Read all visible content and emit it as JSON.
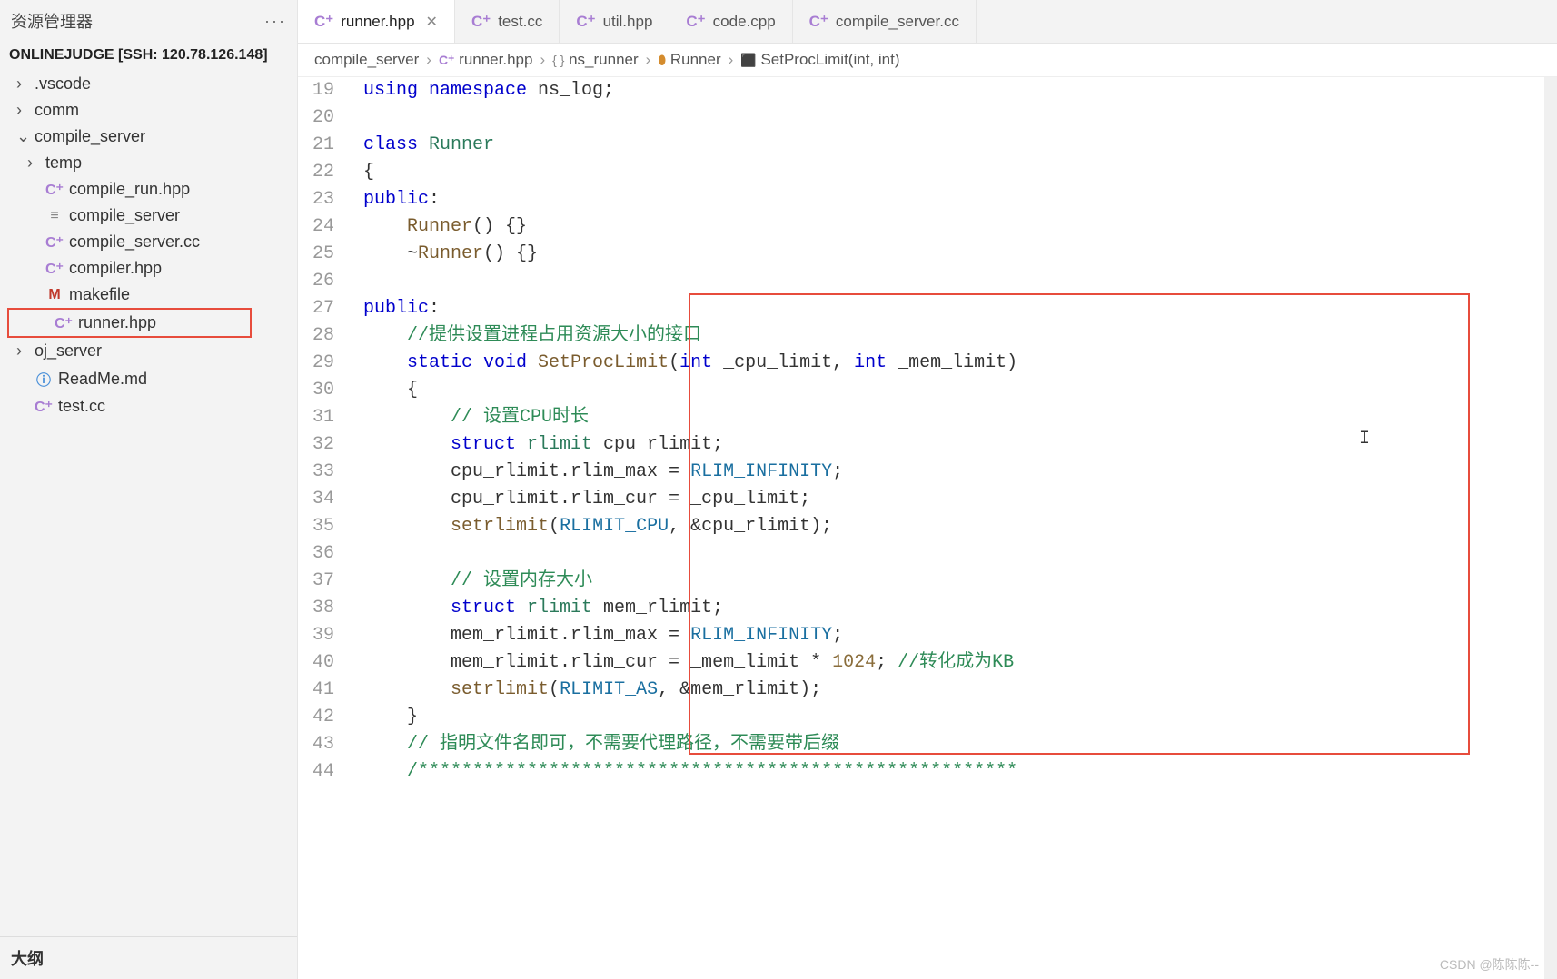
{
  "sidebar": {
    "title": "资源管理器",
    "workspace": "ONLINEJUDGE [SSH: 120.78.126.148]",
    "outline": "大纲",
    "items": [
      {
        "label": ".vscode",
        "type": "folder",
        "indent": 0,
        "expanded": false
      },
      {
        "label": "comm",
        "type": "folder",
        "indent": 0,
        "expanded": false
      },
      {
        "label": "compile_server",
        "type": "folder",
        "indent": 0,
        "expanded": true
      },
      {
        "label": "temp",
        "type": "folder",
        "indent": 1,
        "expanded": false
      },
      {
        "label": "compile_run.hpp",
        "type": "hpp",
        "indent": 1
      },
      {
        "label": "compile_server",
        "type": "file",
        "indent": 1
      },
      {
        "label": "compile_server.cc",
        "type": "cpp",
        "indent": 1
      },
      {
        "label": "compiler.hpp",
        "type": "hpp",
        "indent": 1
      },
      {
        "label": "makefile",
        "type": "m",
        "indent": 1
      },
      {
        "label": "runner.hpp",
        "type": "hpp",
        "indent": 1,
        "highlight": true
      },
      {
        "label": "oj_server",
        "type": "folder",
        "indent": 0,
        "expanded": false
      },
      {
        "label": "ReadMe.md",
        "type": "md",
        "indent": 0
      },
      {
        "label": "test.cc",
        "type": "cpp",
        "indent": 0
      }
    ]
  },
  "tabs": [
    {
      "label": "runner.hpp",
      "icon": "hpp",
      "active": true,
      "hasClose": true
    },
    {
      "label": "test.cc",
      "icon": "cpp",
      "active": false
    },
    {
      "label": "util.hpp",
      "icon": "hpp",
      "active": false
    },
    {
      "label": "code.cpp",
      "icon": "cpp",
      "active": false
    },
    {
      "label": "compile_server.cc",
      "icon": "cpp",
      "active": false
    }
  ],
  "breadcrumb": [
    {
      "label": "compile_server",
      "icon": ""
    },
    {
      "label": "runner.hpp",
      "icon": "hpp"
    },
    {
      "label": "ns_runner",
      "icon": "braces"
    },
    {
      "label": "Runner",
      "icon": "class"
    },
    {
      "label": "SetProcLimit(int, int)",
      "icon": "method"
    }
  ],
  "code": {
    "startLine": 19,
    "lines": [
      {
        "n": 19,
        "tokens": [
          {
            "t": "using ",
            "c": "kw"
          },
          {
            "t": "namespace",
            "c": "kw"
          },
          {
            "t": " ns_log;",
            "c": ""
          }
        ]
      },
      {
        "n": 20,
        "tokens": []
      },
      {
        "n": 21,
        "tokens": [
          {
            "t": "class ",
            "c": "kw"
          },
          {
            "t": "Runner",
            "c": "type"
          }
        ]
      },
      {
        "n": 22,
        "tokens": [
          {
            "t": "{",
            "c": ""
          }
        ]
      },
      {
        "n": 23,
        "tokens": [
          {
            "t": "public",
            "c": "kw"
          },
          {
            "t": ":",
            "c": ""
          }
        ]
      },
      {
        "n": 24,
        "tokens": [
          {
            "t": "    ",
            "c": ""
          },
          {
            "t": "Runner",
            "c": "func"
          },
          {
            "t": "() {}",
            "c": ""
          }
        ]
      },
      {
        "n": 25,
        "tokens": [
          {
            "t": "    ~",
            "c": ""
          },
          {
            "t": "Runner",
            "c": "func"
          },
          {
            "t": "() {}",
            "c": ""
          }
        ]
      },
      {
        "n": 26,
        "tokens": []
      },
      {
        "n": 27,
        "tokens": [
          {
            "t": "public",
            "c": "kw"
          },
          {
            "t": ":",
            "c": ""
          }
        ]
      },
      {
        "n": 28,
        "tokens": [
          {
            "t": "    ",
            "c": ""
          },
          {
            "t": "//提供设置进程占用资源大小的接口",
            "c": "comment"
          }
        ]
      },
      {
        "n": 29,
        "tokens": [
          {
            "t": "    ",
            "c": ""
          },
          {
            "t": "static ",
            "c": "kw"
          },
          {
            "t": "void ",
            "c": "kw"
          },
          {
            "t": "SetProcLimit",
            "c": "func"
          },
          {
            "t": "(",
            "c": ""
          },
          {
            "t": "int",
            "c": "kw"
          },
          {
            "t": " _cpu_limit, ",
            "c": ""
          },
          {
            "t": "int",
            "c": "kw"
          },
          {
            "t": " _mem_limit)",
            "c": ""
          }
        ]
      },
      {
        "n": 30,
        "tokens": [
          {
            "t": "    {",
            "c": ""
          }
        ]
      },
      {
        "n": 31,
        "tokens": [
          {
            "t": "        ",
            "c": ""
          },
          {
            "t": "// 设置CPU时长",
            "c": "comment"
          }
        ]
      },
      {
        "n": 32,
        "tokens": [
          {
            "t": "        ",
            "c": ""
          },
          {
            "t": "struct ",
            "c": "kw"
          },
          {
            "t": "rlimit",
            "c": "type"
          },
          {
            "t": " cpu_rlimit;",
            "c": ""
          }
        ]
      },
      {
        "n": 33,
        "tokens": [
          {
            "t": "        cpu_rlimit.rlim_max = ",
            "c": ""
          },
          {
            "t": "RLIM_INFINITY",
            "c": "const"
          },
          {
            "t": ";",
            "c": ""
          }
        ]
      },
      {
        "n": 34,
        "tokens": [
          {
            "t": "        cpu_rlimit.rlim_cur = _cpu_limit;",
            "c": ""
          }
        ]
      },
      {
        "n": 35,
        "tokens": [
          {
            "t": "        ",
            "c": ""
          },
          {
            "t": "setrlimit",
            "c": "func"
          },
          {
            "t": "(",
            "c": ""
          },
          {
            "t": "RLIMIT_CPU",
            "c": "const"
          },
          {
            "t": ", &cpu_rlimit);",
            "c": ""
          }
        ]
      },
      {
        "n": 36,
        "tokens": []
      },
      {
        "n": 37,
        "tokens": [
          {
            "t": "        ",
            "c": ""
          },
          {
            "t": "// 设置内存大小",
            "c": "comment"
          }
        ]
      },
      {
        "n": 38,
        "tokens": [
          {
            "t": "        ",
            "c": ""
          },
          {
            "t": "struct ",
            "c": "kw"
          },
          {
            "t": "rlimit",
            "c": "type"
          },
          {
            "t": " mem_rlimit;",
            "c": ""
          }
        ]
      },
      {
        "n": 39,
        "tokens": [
          {
            "t": "        mem_rlimit.rlim_max = ",
            "c": ""
          },
          {
            "t": "RLIM_INFINITY",
            "c": "const"
          },
          {
            "t": ";",
            "c": ""
          }
        ]
      },
      {
        "n": 40,
        "tokens": [
          {
            "t": "        mem_rlimit.rlim_cur = _mem_limit * ",
            "c": ""
          },
          {
            "t": "1024",
            "c": "num"
          },
          {
            "t": "; ",
            "c": ""
          },
          {
            "t": "//转化成为KB",
            "c": "comment"
          }
        ]
      },
      {
        "n": 41,
        "tokens": [
          {
            "t": "        ",
            "c": ""
          },
          {
            "t": "setrlimit",
            "c": "func"
          },
          {
            "t": "(",
            "c": ""
          },
          {
            "t": "RLIMIT_AS",
            "c": "const"
          },
          {
            "t": ", &mem_rlimit);",
            "c": ""
          }
        ]
      },
      {
        "n": 42,
        "tokens": [
          {
            "t": "    }",
            "c": ""
          }
        ]
      },
      {
        "n": 43,
        "tokens": [
          {
            "t": "    ",
            "c": ""
          },
          {
            "t": "// 指明文件名即可，不需要代理路径，不需要带后缀",
            "c": "comment"
          }
        ]
      },
      {
        "n": 44,
        "tokens": [
          {
            "t": "    ",
            "c": ""
          },
          {
            "t": "/*******************************************************",
            "c": "comment"
          }
        ]
      }
    ]
  },
  "watermark": "CSDN @陈陈陈--"
}
